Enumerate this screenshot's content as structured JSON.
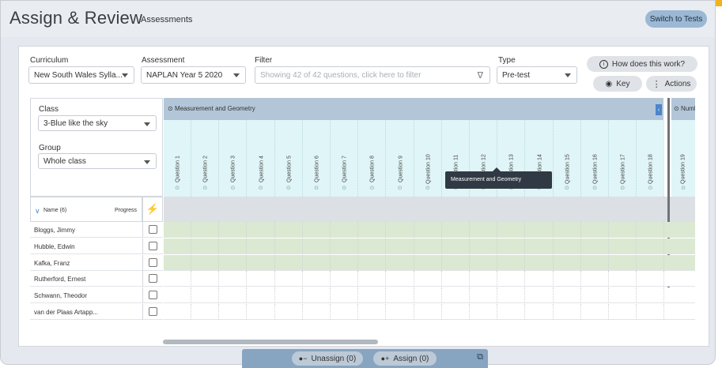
{
  "app": {
    "title": "Assign & Review",
    "subtitle": "Assessments",
    "switch_label": "Switch to Tests"
  },
  "filters": {
    "curriculum": {
      "label": "Curriculum",
      "value": "New South Wales Sylla..."
    },
    "assessment": {
      "label": "Assessment",
      "value": "NAPLAN Year 5 2020"
    },
    "filter": {
      "label": "Filter",
      "placeholder": "Showing 42 of 42 questions, click here to filter"
    },
    "type": {
      "label": "Type",
      "value": "Pre-test"
    }
  },
  "help": {
    "how_label": "How does this work?",
    "key_label": "Key",
    "actions_label": "Actions"
  },
  "class_panel": {
    "class_label": "Class",
    "class_value": "3-Blue like the sky",
    "group_label": "Group",
    "group_value": "Whole class"
  },
  "grid": {
    "category": "Measurement and Geometry",
    "category2": "Numb",
    "questions": [
      "Question 1",
      "Question 2",
      "Question 3",
      "Question 4",
      "Question 5",
      "Question 6",
      "Question 7",
      "Question 8",
      "Question 9",
      "Question 10",
      "Question 11",
      "Question 12",
      "Question 13",
      "Question 14",
      "Question 15",
      "Question 16",
      "Question 17",
      "Question 18"
    ],
    "question_extra": "Question 19",
    "tooltip": "Measurement and Geometry"
  },
  "students": {
    "name_header": "Name (6)",
    "progress_header": "Progress",
    "rows": [
      {
        "name": "Bloggs, Jimmy",
        "assigned": true
      },
      {
        "name": "Hubble, Edwin",
        "assigned": true
      },
      {
        "name": "Kafka, Franz",
        "assigned": true
      },
      {
        "name": "Rutherford, Ernest",
        "assigned": false
      },
      {
        "name": "Schwann, Theodor",
        "assigned": false
      },
      {
        "name": "van der Plaas Artapp...",
        "assigned": false
      }
    ]
  },
  "actions": {
    "unassign_label": "Unassign (0)",
    "assign_label": "Assign (0)"
  },
  "colors": {
    "assigned_row": "#dbe8d2",
    "header_bar": "#b2c6d8",
    "question_bg": "#e0f5f7",
    "accent": "#4a8bd0"
  }
}
